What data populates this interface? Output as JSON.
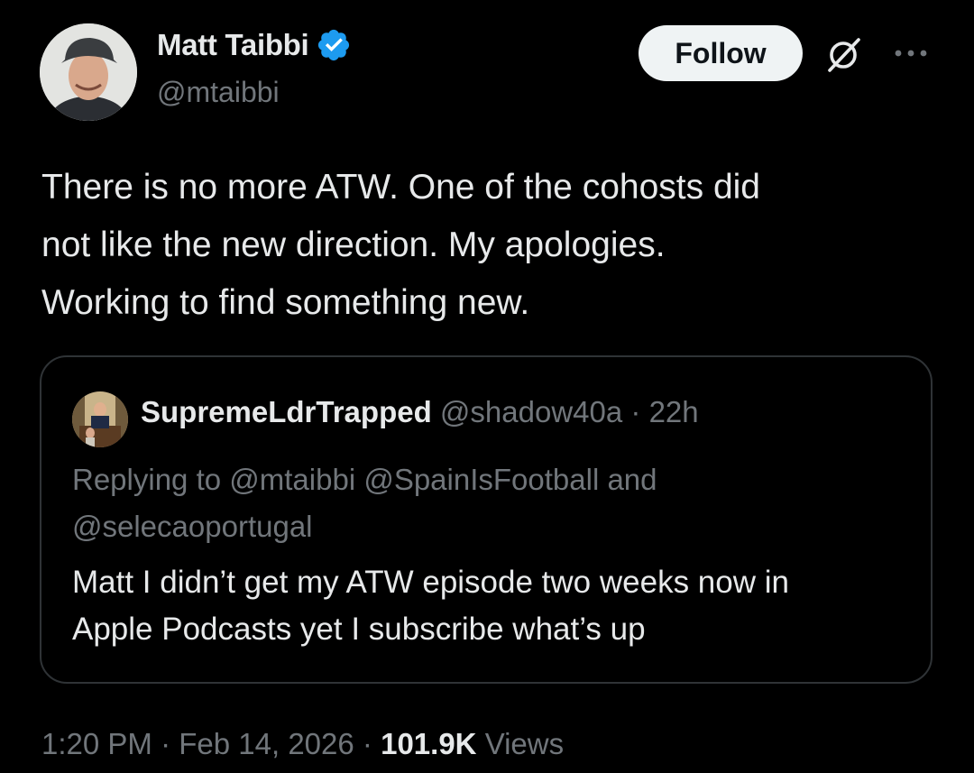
{
  "tweet": {
    "author": {
      "name": "Matt Taibbi",
      "handle": "@mtaibbi",
      "verified": true,
      "avatar": "person-photo-avatar"
    },
    "follow_label": "Follow",
    "icons": {
      "grok": "grok-icon",
      "more": "more-options-icon",
      "verified": "verified-badge-icon"
    },
    "text_lines": [
      "There is no more ATW. One of the cohosts did",
      "not like the new direction. My apologies.",
      "Working to find something new."
    ],
    "quote": {
      "name": "SupremeLdrTrapped",
      "handle": "@shadow40a",
      "separator": "·",
      "time": "22h",
      "reply_lines": [
        "Replying to @mtaibbi @SpainIsFootball and",
        "@selecaoportugal"
      ],
      "text_lines": [
        "Matt I didn’t get my ATW episode two weeks now in",
        "Apple Podcasts yet I subscribe what’s up"
      ]
    },
    "meta": {
      "time": "1:20 PM",
      "separator": "·",
      "date": "Feb 14, 2026",
      "views_count": "101.9K",
      "views_label": "Views"
    }
  },
  "colors": {
    "background": "#000000",
    "primary_text": "#e7e9ea",
    "secondary_text": "#71767b",
    "verified_blue": "#1d9bf0",
    "border": "#2f3336",
    "follow_bg": "#eff3f4"
  }
}
